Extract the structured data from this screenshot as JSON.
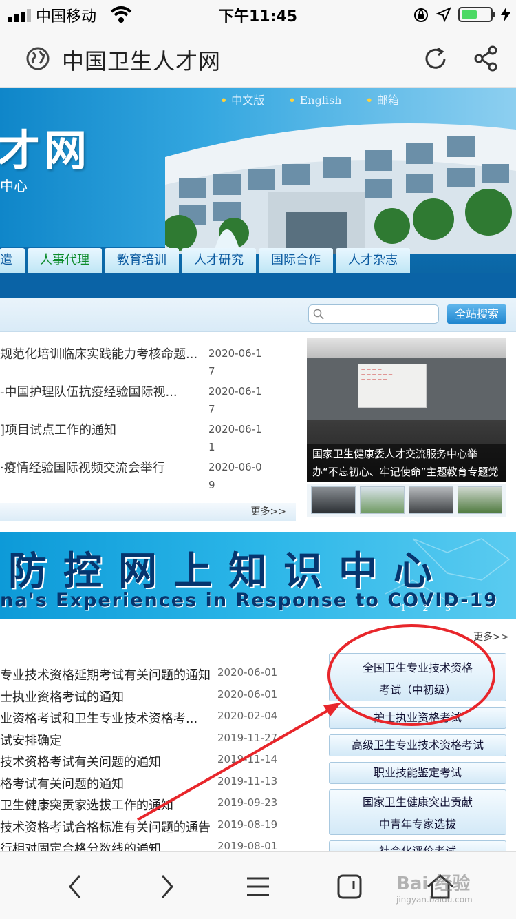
{
  "status_bar": {
    "carrier": "中国移动",
    "time": "下午11:45",
    "battery_color": "#4cd964"
  },
  "browser": {
    "page_title": "中国卫生人才网",
    "icons": [
      "globe-icon",
      "refresh-icon",
      "share-icon"
    ]
  },
  "header": {
    "top_links": [
      "中文版",
      "English",
      "邮箱"
    ],
    "logo_text": "才网",
    "logo_sub": "中心",
    "nav_tabs": [
      "遣",
      "人事代理",
      "教育培训",
      "人才研究",
      "国际合作",
      "人才杂志"
    ],
    "active_tab": "人事代理"
  },
  "search": {
    "button_label": "全站搜索",
    "placeholder": ""
  },
  "news": {
    "items": [
      {
        "title": "规范化培训临床实践能力考核命题...",
        "date": "2020-06-17"
      },
      {
        "title": "-中国护理队伍抗疫经验国际视...",
        "date": "2020-06-17"
      },
      {
        "title": "]项目试点工作的通知",
        "date": "2020-06-11"
      },
      {
        "title": "·疫情经验国际视频交流会举行",
        "date": "2020-06-09"
      }
    ],
    "more_label": "更多>>"
  },
  "photo": {
    "caption": "国家卫生健康委人才交流服务中心举办“不忘初心、牢记使命”主题教育专题党课"
  },
  "covid_banner": {
    "title_cn": "防控网上知识中心",
    "title_en": "na's Experiences in Response to COVID-19",
    "pages": [
      "1",
      "2",
      "3"
    ]
  },
  "exams": {
    "more_label": "更多>>",
    "items": [
      {
        "title": "专业技术资格延期考试有关问题的通知",
        "date": "2020-06-01"
      },
      {
        "title": "士执业资格考试的通知",
        "date": "2020-06-01"
      },
      {
        "title": "业资格考试和卫生专业技术资格考...",
        "date": "2020-02-04"
      },
      {
        "title": "试安排确定",
        "date": "2019-11-27"
      },
      {
        "title": "技术资格考试有关问题的通知",
        "date": "2019-11-14"
      },
      {
        "title": "格考试有关问题的通知",
        "date": "2019-11-13"
      },
      {
        "title": "卫生健康突贡家选拔工作的通知",
        "date": "2019-09-23"
      },
      {
        "title": "技术资格考试合格标准有关问题的通告",
        "date": "2019-08-19"
      },
      {
        "title": "行相对固定合格分数线的通知",
        "date": "2019-08-01"
      }
    ],
    "buttons": [
      {
        "line1": "全国卫生专业技术资格",
        "line2": "考试（中初级）"
      },
      {
        "line1": "护士执业资格考试",
        "line2": ""
      },
      {
        "line1": "高级卫生专业技术资格考试",
        "line2": ""
      },
      {
        "line1": "职业技能鉴定考试",
        "line2": ""
      },
      {
        "line1": "国家卫生健康突出贡献",
        "line2": "中青年专家选拔"
      },
      {
        "line1": "社会化评价考试",
        "line2": ""
      }
    ],
    "highlight_color": "#e8262b"
  },
  "toolbar": {
    "icons": [
      "back-icon",
      "forward-icon",
      "menu-icon",
      "tabs-icon",
      "home-icon"
    ]
  },
  "watermark": {
    "text": "Bai 经验",
    "sub": "jingyan.baidu.com"
  }
}
